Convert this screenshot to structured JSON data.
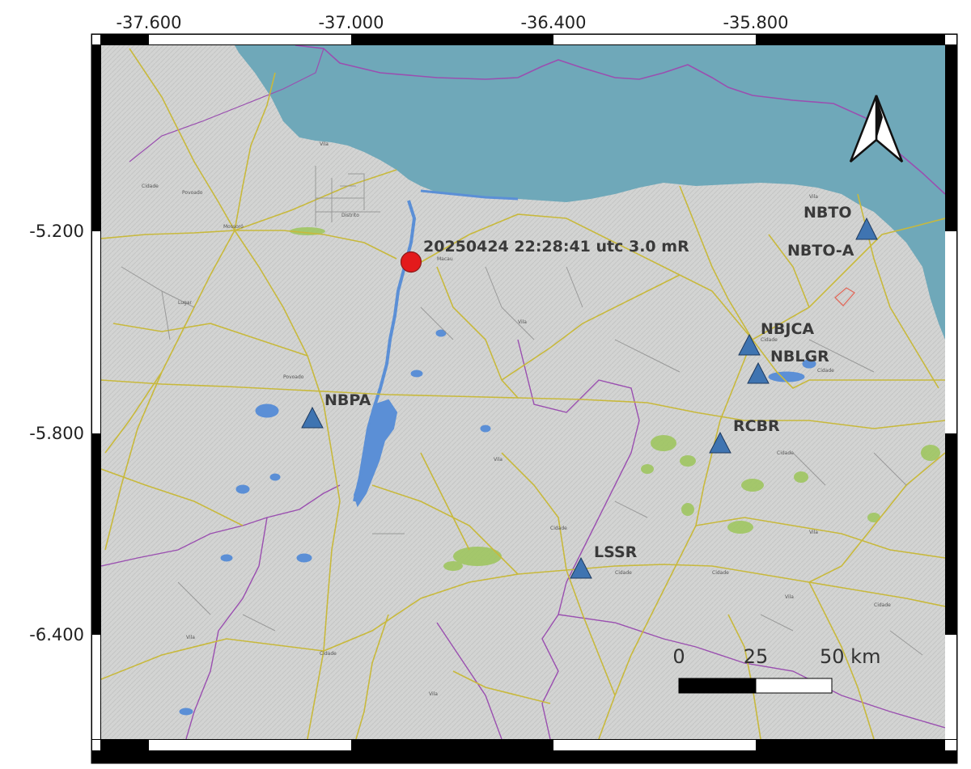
{
  "map": {
    "x_ticks": [
      "-37.600",
      "-37.000",
      "-36.400",
      "-35.800"
    ],
    "y_ticks": [
      "-5.200",
      "-5.800",
      "-6.400"
    ],
    "colors": {
      "sea": "#6fa8b9",
      "land": "#cfd0cf",
      "road": "#c8b93c",
      "boundary": "#9a4fb0",
      "water": "#5b8fd6",
      "vegetation": "#9cc55a",
      "station": "#3f74b1",
      "event": "#e31a1c"
    },
    "event": {
      "label": "20250424 22:28:41 utc 3.0 mR",
      "icon": "event-circle-icon"
    },
    "stations": [
      {
        "name": "NBTO",
        "icon": "station-triangle-icon"
      },
      {
        "name": "NBTO-A",
        "icon": "station-triangle-icon"
      },
      {
        "name": "NBJCA",
        "icon": "station-triangle-icon"
      },
      {
        "name": "NBLGR",
        "icon": "station-triangle-icon"
      },
      {
        "name": "NBPA",
        "icon": "station-triangle-icon"
      },
      {
        "name": "RCBR",
        "icon": "station-triangle-icon"
      },
      {
        "name": "LSSR",
        "icon": "station-triangle-icon"
      }
    ],
    "scale_bar": {
      "labels": [
        "0",
        "25",
        "50 km"
      ]
    },
    "north_arrow": {
      "icon": "north-arrow-icon"
    }
  }
}
